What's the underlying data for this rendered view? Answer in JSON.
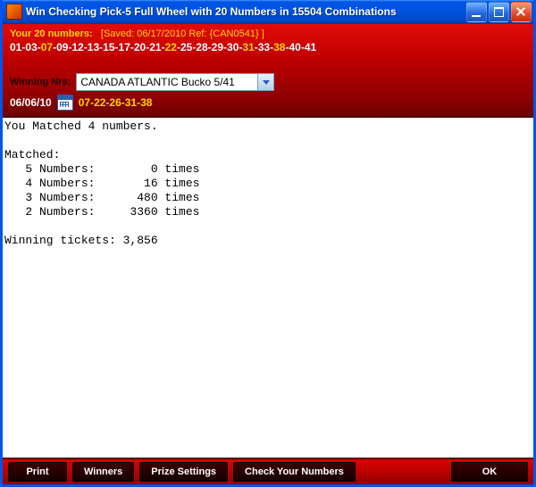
{
  "window": {
    "title": "Win Checking Pick-5 Full Wheel with 20 Numbers in 15504 Combinations"
  },
  "header": {
    "your_numbers_label": "Your 20 numbers:",
    "saved_label": "[Saved: 06/17/2010 Ref: {CAN0541} ]",
    "numbers": [
      {
        "n": "01",
        "hit": false
      },
      {
        "n": "03",
        "hit": false
      },
      {
        "n": "07",
        "hit": true
      },
      {
        "n": "09",
        "hit": false
      },
      {
        "n": "12",
        "hit": false
      },
      {
        "n": "13",
        "hit": false
      },
      {
        "n": "15",
        "hit": false
      },
      {
        "n": "17",
        "hit": false
      },
      {
        "n": "20",
        "hit": false
      },
      {
        "n": "21",
        "hit": false
      },
      {
        "n": "22",
        "hit": true
      },
      {
        "n": "25",
        "hit": false
      },
      {
        "n": "28",
        "hit": false
      },
      {
        "n": "29",
        "hit": false
      },
      {
        "n": "30",
        "hit": false
      },
      {
        "n": "31",
        "hit": true
      },
      {
        "n": "33",
        "hit": false
      },
      {
        "n": "38",
        "hit": true
      },
      {
        "n": "40",
        "hit": false
      },
      {
        "n": "41",
        "hit": false
      }
    ],
    "winning_label": "Winning Nrs:",
    "lottery_selected": "CANADA ATLANTIC Bucko 5/41",
    "draw_date": "06/06/10",
    "winning_numbers": "07-22-26-31-38"
  },
  "results_text": "You Matched 4 numbers.\n\nMatched:\n   5 Numbers:        0 times\n   4 Numbers:       16 times\n   3 Numbers:      480 times\n   2 Numbers:     3360 times\n\nWinning tickets: 3,856",
  "buttons": {
    "print": "Print",
    "winners": "Winners",
    "prize_settings": "Prize Settings",
    "check": "Check Your Numbers",
    "ok": "OK"
  }
}
